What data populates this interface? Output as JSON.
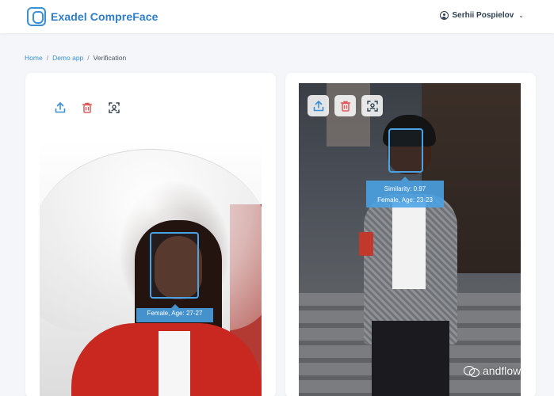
{
  "app": {
    "name": "Exadel CompreFace",
    "logo_icon": "face-logo-icon"
  },
  "header": {
    "user_name": "Serhii Pospielov",
    "user_icon": "user-circle-icon",
    "menu_icon": "chevron-down-icon"
  },
  "breadcrumb": {
    "items": [
      "Home",
      "Demo app",
      "Verification"
    ],
    "separator": "/"
  },
  "toolbar": {
    "upload_icon": "upload-icon",
    "delete_icon": "delete-icon",
    "scan_icon": "face-scan-icon"
  },
  "left_panel": {
    "face_label": "Female, Age: 27-27"
  },
  "right_panel": {
    "similarity": "Similarity: 0.97",
    "face_label": "Female, Age: 23-23"
  },
  "watermark": {
    "text": "andflow",
    "icon": "wechat-icon"
  },
  "colors": {
    "accent": "#4aa3e6",
    "brand": "#2e7dc6",
    "delete": "#e05a5a",
    "background": "#f4f6fa"
  }
}
